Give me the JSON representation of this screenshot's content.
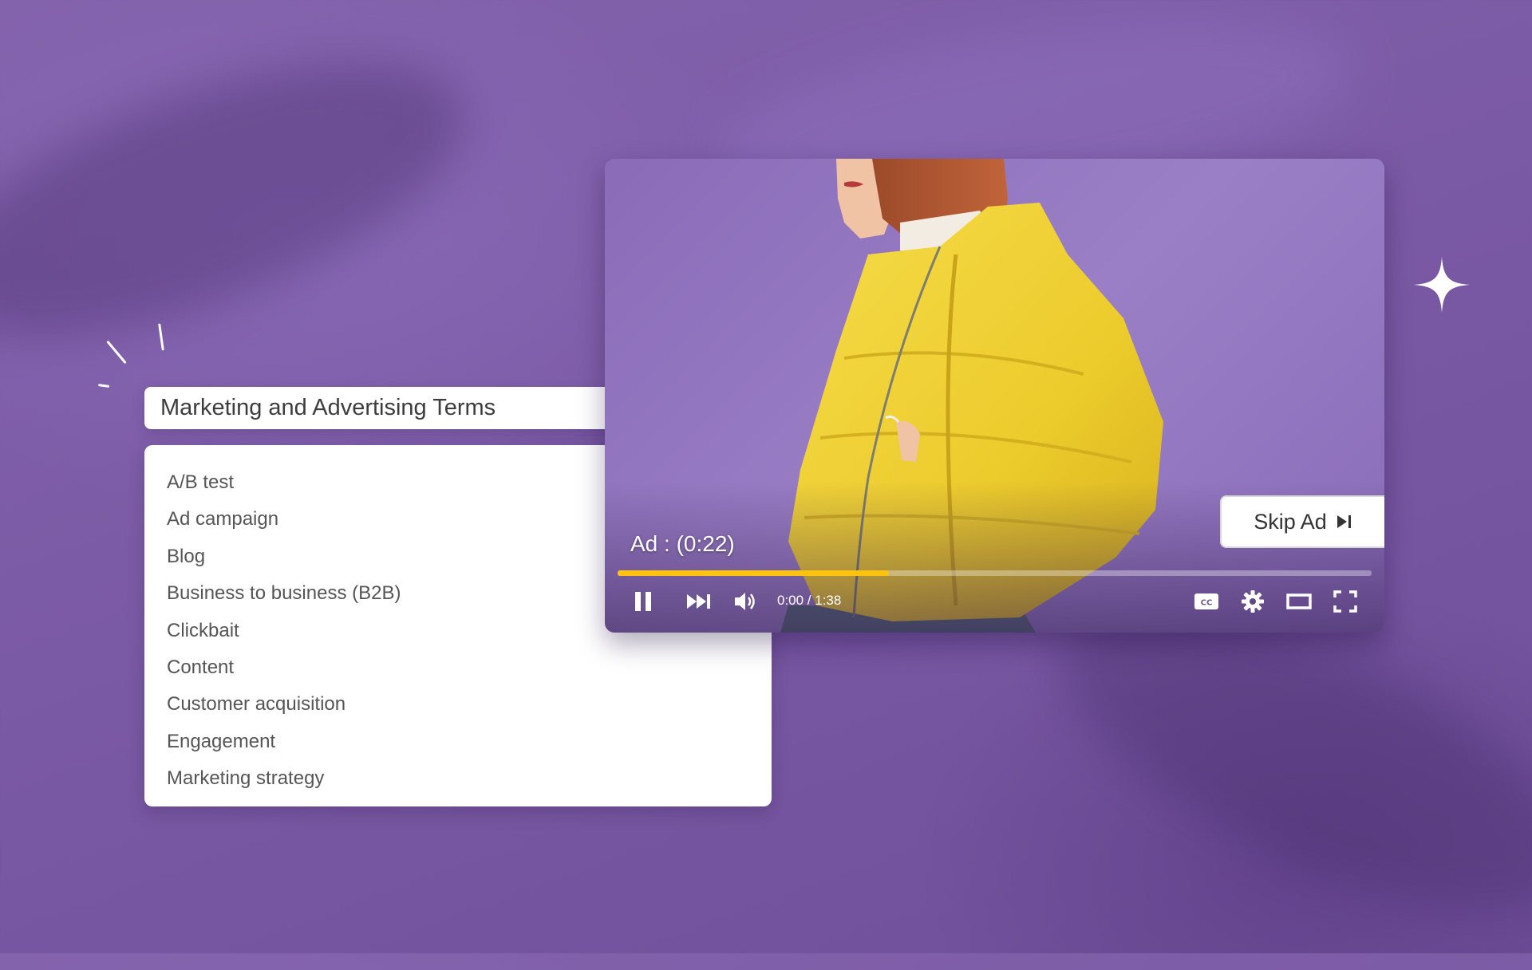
{
  "terms_panel": {
    "title": "Marketing and Advertising Terms",
    "items": [
      "A/B test",
      "Ad campaign",
      "Blog",
      "Business to business (B2B)",
      "Clickbait",
      "Content",
      "Customer acquisition",
      "Engagement",
      "Marketing strategy"
    ]
  },
  "player": {
    "ad_timer": "Ad : (0:22)",
    "skip_label": "Skip Ad",
    "time_display": "0:00 / 1:38",
    "progress_fraction": 0.36,
    "progress_color": "#ffc20e",
    "icons": {
      "pause": "pause-icon",
      "next": "next-icon",
      "volume": "volume-icon",
      "captions": "captions-icon",
      "settings": "gear-icon",
      "theater": "theater-mode-icon",
      "fullscreen": "fullscreen-icon",
      "skip": "skip-next-icon"
    }
  },
  "colors": {
    "background": "#7b5aa5",
    "jacket": "#f3d23a"
  }
}
